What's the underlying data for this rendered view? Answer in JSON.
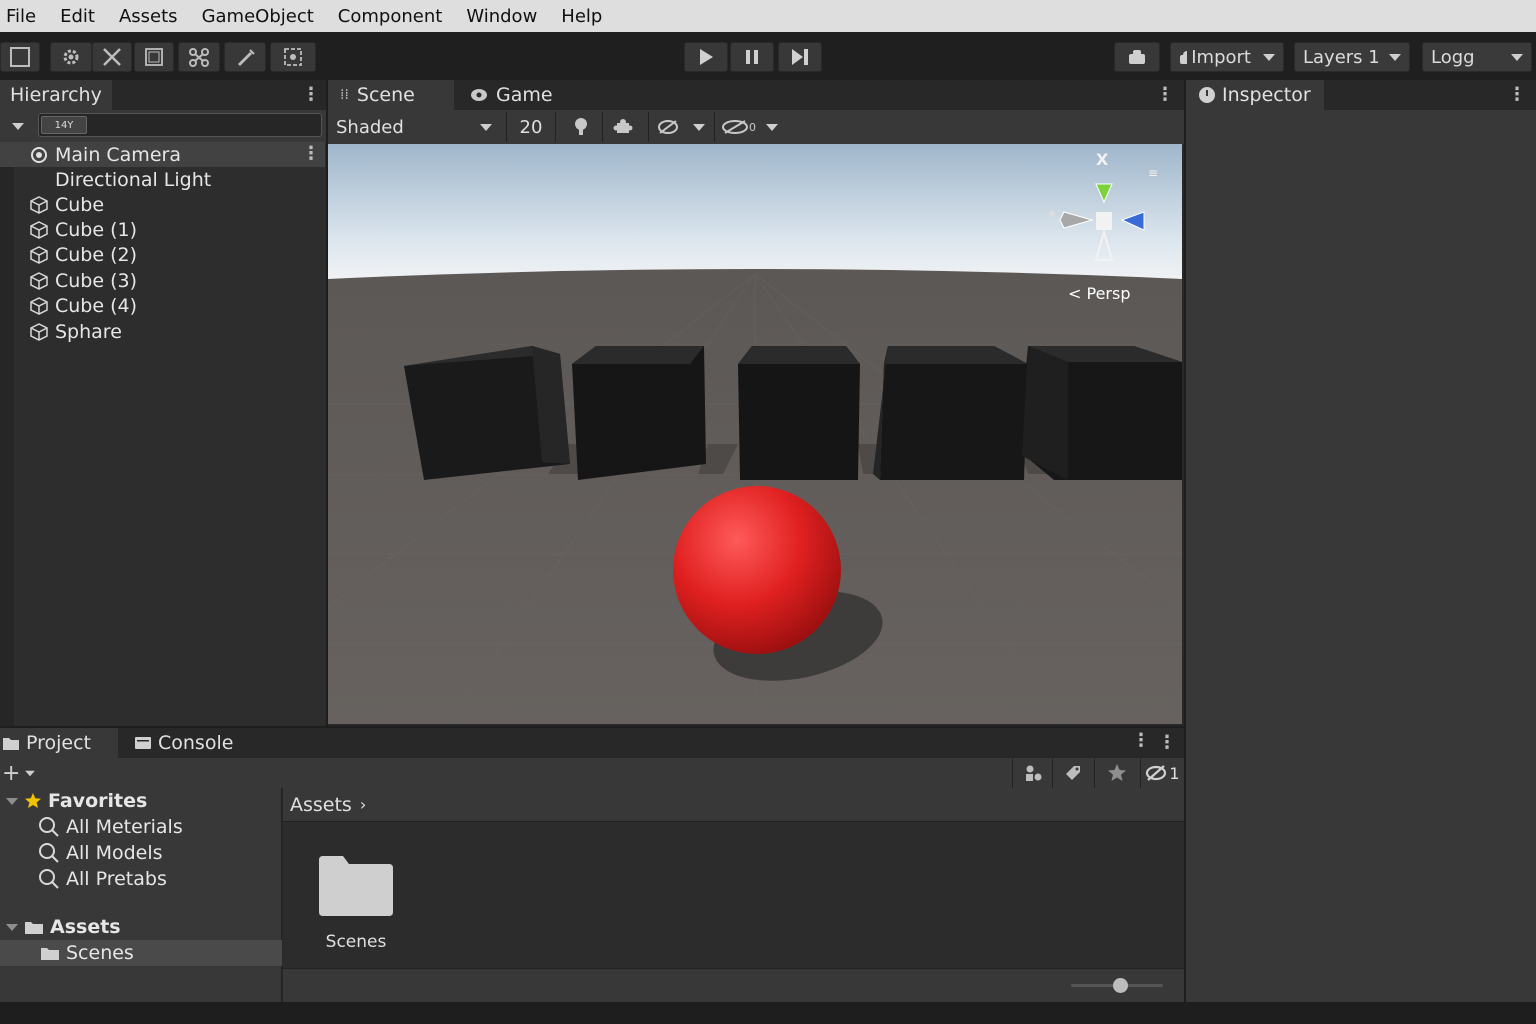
{
  "menu": [
    "File",
    "Edit",
    "Assets",
    "GameObject",
    "Component",
    "Window",
    "Help"
  ],
  "toolbar": {
    "import_label": "Import",
    "layers_label": "Layers 1",
    "layout_label": "Logg"
  },
  "hierarchy": {
    "tab_label": "Hierarchy",
    "search_badge": "14Y",
    "items": [
      {
        "label": "Main Camera",
        "icon": "camera-icon"
      },
      {
        "label": "Directional Light",
        "icon": ""
      },
      {
        "label": "Cube",
        "icon": "cube-icon"
      },
      {
        "label": "Cube (1)",
        "icon": "cube-icon"
      },
      {
        "label": "Cube (2)",
        "icon": "cube-icon"
      },
      {
        "label": "Cube (3)",
        "icon": "cube-icon"
      },
      {
        "label": "Cube (4)",
        "icon": "cube-icon"
      },
      {
        "label": "Sphare",
        "icon": "cube-icon"
      }
    ]
  },
  "scene": {
    "tabs": [
      "Scene",
      "Game"
    ],
    "shading_mode": "Shaded",
    "grid_value": "20",
    "hidden_count": "0",
    "gizmo_axis_label": "X",
    "projection_label": "< Persp"
  },
  "inspector": {
    "tab_label": "Inspector"
  },
  "project": {
    "tabs": [
      "Project",
      "Console"
    ],
    "favorites_label": "Favorites",
    "favorites": [
      "All Meterials",
      "All Models",
      "All Pretabs"
    ],
    "assets_label": "Assets",
    "assets_children": [
      "Scenes"
    ],
    "breadcrumb": "Assets",
    "visibility_count": "1",
    "grid_items": [
      {
        "label": "Scenes",
        "icon": "folder-icon"
      }
    ]
  },
  "colors": {
    "accent_sphere": "#e02020",
    "gizmo_y": "#7bd23a",
    "gizmo_z": "#3a6ad8",
    "favorites_star": "#f2c200"
  }
}
